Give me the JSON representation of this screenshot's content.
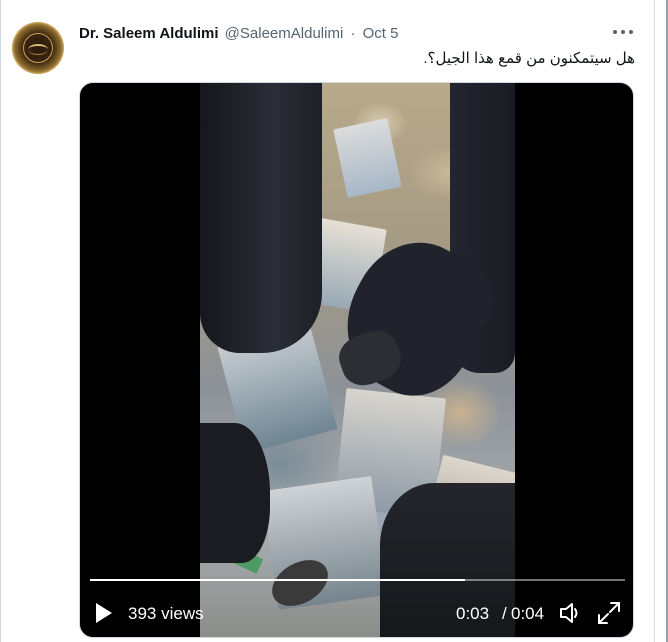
{
  "tweet": {
    "author_name": "Dr. Saleem Aldulimi",
    "handle": "@SaleemAldulimi",
    "separator": "·",
    "date": "Oct 5",
    "text": "هل سيتمكنون من قمع هذا الجيل؟.",
    "more_icon": "ellipsis-icon",
    "avatar_icon": "calligraphy-logo"
  },
  "video": {
    "views": "393 views",
    "current_time": "0:03",
    "time_separator": "/",
    "duration": "0:04",
    "progress": 0.7,
    "play_icon": "play-icon",
    "volume_icon": "volume-icon",
    "fullscreen_icon": "fullscreen-icon"
  },
  "colors": {
    "text_primary": "#0f1419",
    "text_secondary": "#536471",
    "video_bg": "#000000"
  }
}
